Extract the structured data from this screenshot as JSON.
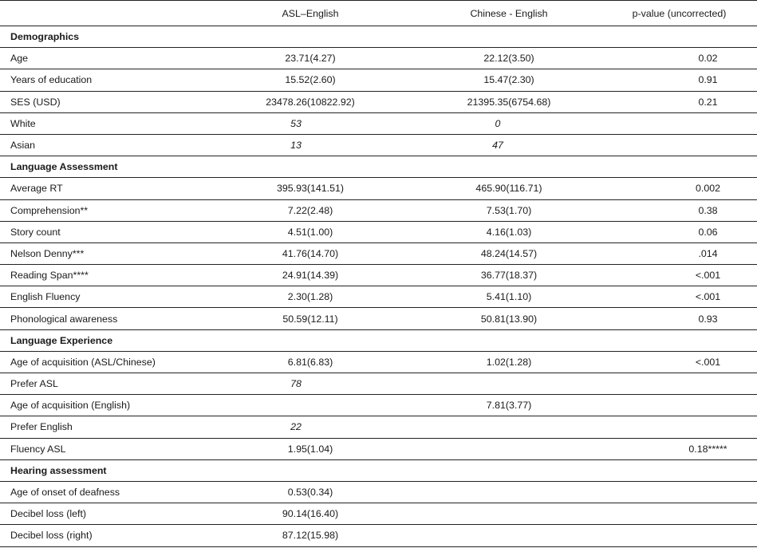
{
  "columns": [
    "",
    "ASL–English",
    "Chinese - English",
    "p-value (uncorrected)"
  ],
  "rows": [
    {
      "type": "section",
      "label": "Demographics"
    },
    {
      "type": "data",
      "label": "Age",
      "asl": "23.71(4.27)",
      "chinese": "22.12(3.50)",
      "p": "0.02"
    },
    {
      "type": "data",
      "label": "Years of education",
      "asl": "15.52(2.60)",
      "chinese": "15.47(2.30)",
      "p": "0.91"
    },
    {
      "type": "data",
      "label": "SES (USD)",
      "asl": "23478.26(10822.92)",
      "chinese": "21395.35(6754.68)",
      "p": "0.21"
    },
    {
      "type": "data",
      "label": "White",
      "asl": "53",
      "chinese": "0",
      "p": "",
      "italic": true
    },
    {
      "type": "data",
      "label": "Asian",
      "asl": "13",
      "chinese": "47",
      "p": "",
      "italic": true
    },
    {
      "type": "section",
      "label": "Language Assessment"
    },
    {
      "type": "data",
      "label": "Average RT",
      "asl": "395.93(141.51)",
      "chinese": "465.90(116.71)",
      "p": "0.002"
    },
    {
      "type": "data",
      "label": "Comprehension**",
      "asl": "7.22(2.48)",
      "chinese": "7.53(1.70)",
      "p": "0.38"
    },
    {
      "type": "data",
      "label": "Story count",
      "asl": "4.51(1.00)",
      "chinese": "4.16(1.03)",
      "p": "0.06"
    },
    {
      "type": "data",
      "label": "Nelson Denny***",
      "asl": "41.76(14.70)",
      "chinese": "48.24(14.57)",
      "p": ".014"
    },
    {
      "type": "data",
      "label": "Reading Span****",
      "asl": "24.91(14.39)",
      "chinese": "36.77(18.37)",
      "p": "<.001"
    },
    {
      "type": "data",
      "label": "English Fluency",
      "asl": "2.30(1.28)",
      "chinese": "5.41(1.10)",
      "p": "<.001"
    },
    {
      "type": "data",
      "label": "Phonological awareness",
      "asl": "50.59(12.11)",
      "chinese": "50.81(13.90)",
      "p": "0.93"
    },
    {
      "type": "section",
      "label": "Language Experience"
    },
    {
      "type": "data",
      "label": "Age of acquisition (ASL/Chinese)",
      "asl": "6.81(6.83)",
      "chinese": "1.02(1.28)",
      "p": "<.001"
    },
    {
      "type": "data",
      "label": "Prefer ASL",
      "asl": "78",
      "chinese": "",
      "p": "",
      "italic": true
    },
    {
      "type": "data",
      "label": "Age of acquisition (English)",
      "asl": "",
      "chinese": "7.81(3.77)",
      "p": ""
    },
    {
      "type": "data",
      "label": "Prefer English",
      "asl": "22",
      "chinese": "",
      "p": "",
      "italic": true
    },
    {
      "type": "data",
      "label": "Fluency ASL",
      "asl": "1.95(1.04)",
      "chinese": "",
      "p": "0.18*****"
    },
    {
      "type": "section",
      "label": "Hearing assessment"
    },
    {
      "type": "data",
      "label": "Age of onset of deafness",
      "asl": "0.53(0.34)",
      "chinese": "",
      "p": ""
    },
    {
      "type": "data",
      "label": "Decibel loss (left)",
      "asl": "90.14(16.40)",
      "chinese": "",
      "p": ""
    },
    {
      "type": "data",
      "label": "Decibel loss (right)",
      "asl": "87.12(15.98)",
      "chinese": "",
      "p": ""
    }
  ]
}
